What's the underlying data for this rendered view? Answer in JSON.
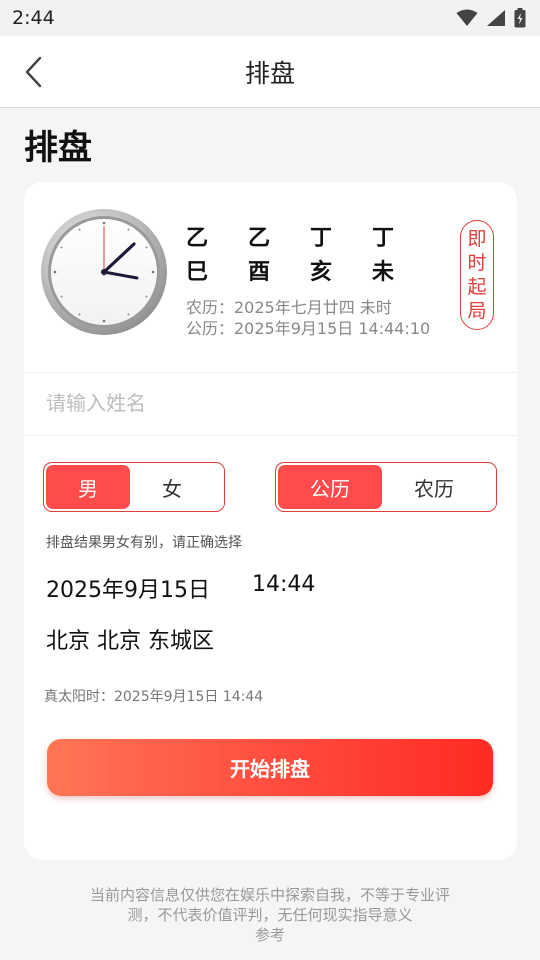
{
  "status_bar": {
    "time": "2:44",
    "icons": [
      "wifi-icon",
      "signal-icon",
      "battery-icon"
    ]
  },
  "nav": {
    "title": "排盘"
  },
  "page": {
    "heading": "排盘"
  },
  "bazi": {
    "stems": [
      "乙",
      "乙",
      "丁",
      "丁"
    ],
    "branches": [
      "巳",
      "酉",
      "亥",
      "未"
    ],
    "lunar": "农历：2025年七月廿四 未时",
    "solar": "公历：2025年9月15日 14:44:10",
    "instant_button": [
      "即",
      "时",
      "起",
      "局"
    ]
  },
  "form": {
    "name_placeholder": "请输入姓名",
    "name_value": "",
    "gender": {
      "male": "男",
      "female": "女",
      "selected": "男"
    },
    "calendar": {
      "solar": "公历",
      "lunar": "农历",
      "selected": "公历"
    },
    "hint": "排盘结果男女有别，请正确选择",
    "date": "2025年9月15日",
    "time": "14:44",
    "location": "北京 北京 东城区",
    "true_solar_time": "真太阳时：2025年9月15日  14:44",
    "start_button": "开始排盘"
  },
  "disclaimer": {
    "line1": "当前内容信息仅供您在娱乐中探索自我，不等于专业评",
    "line2": "测，不代表价值评判，无任何现实指导意义",
    "line3": "参考"
  },
  "colors": {
    "accent": "#ff4b4b",
    "accent_border": "#e0403a",
    "button_gradient_start": "#ff7655",
    "button_gradient_end": "#ff2a22"
  }
}
